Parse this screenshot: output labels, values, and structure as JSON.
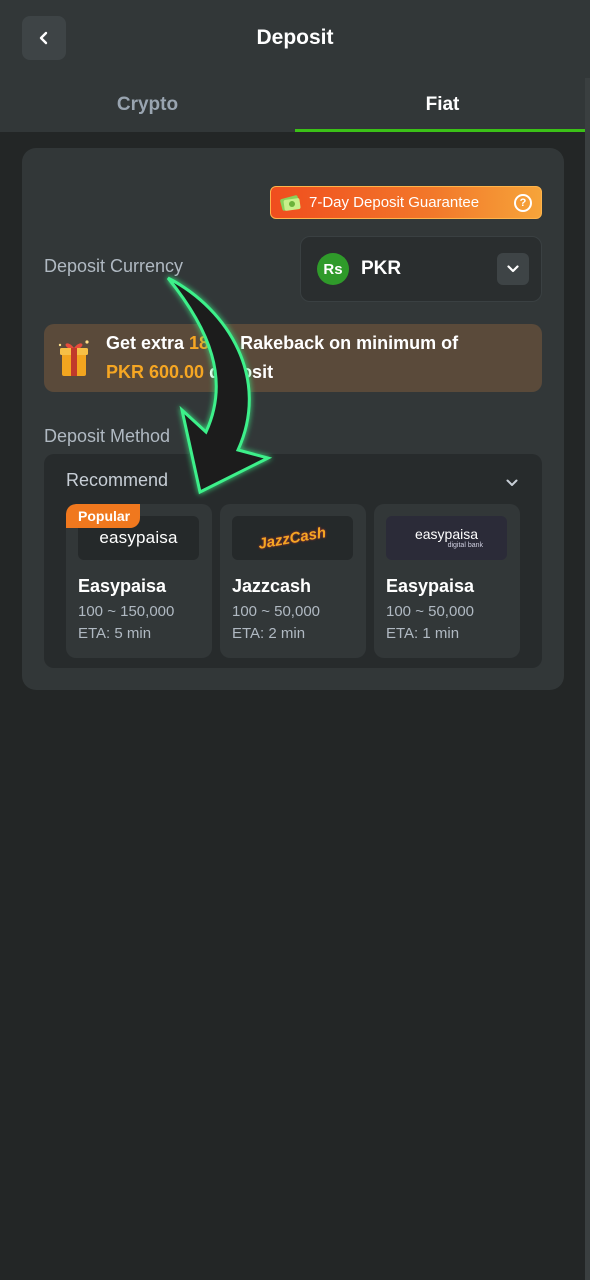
{
  "header": {
    "title": "Deposit"
  },
  "tabs": [
    {
      "label": "Crypto",
      "active": false
    },
    {
      "label": "Fiat",
      "active": true
    }
  ],
  "guarantee": {
    "label": "7-Day Deposit Guarantee"
  },
  "currency": {
    "label": "Deposit Currency",
    "symbol": "Rs",
    "code": "PKR"
  },
  "promo": {
    "prefix": "Get extra ",
    "percent": "180%",
    "middle": " Rakeback on minimum of",
    "amount": "PKR 600.00",
    "suffix": " deposit"
  },
  "methods": {
    "label": "Deposit Method",
    "group": "Recommend",
    "items": [
      {
        "name": "Easypaisa",
        "logo": "easypaisa",
        "range": "100 ~ 150,000",
        "eta": "ETA: 5 min",
        "badge": "Popular"
      },
      {
        "name": "Jazzcash",
        "logo": "JazzCash",
        "range": "100 ~ 50,000",
        "eta": "ETA: 2 min",
        "badge": ""
      },
      {
        "name": "Easypaisa",
        "logo": "easypaisa",
        "logo_sub": "digital bank",
        "range": "100 ~ 50,000",
        "eta": "ETA: 1 min",
        "badge": ""
      }
    ]
  },
  "colors": {
    "accent": "#3bc117",
    "background": "#232626",
    "card": "#323738",
    "highlight": "#f5a623"
  }
}
